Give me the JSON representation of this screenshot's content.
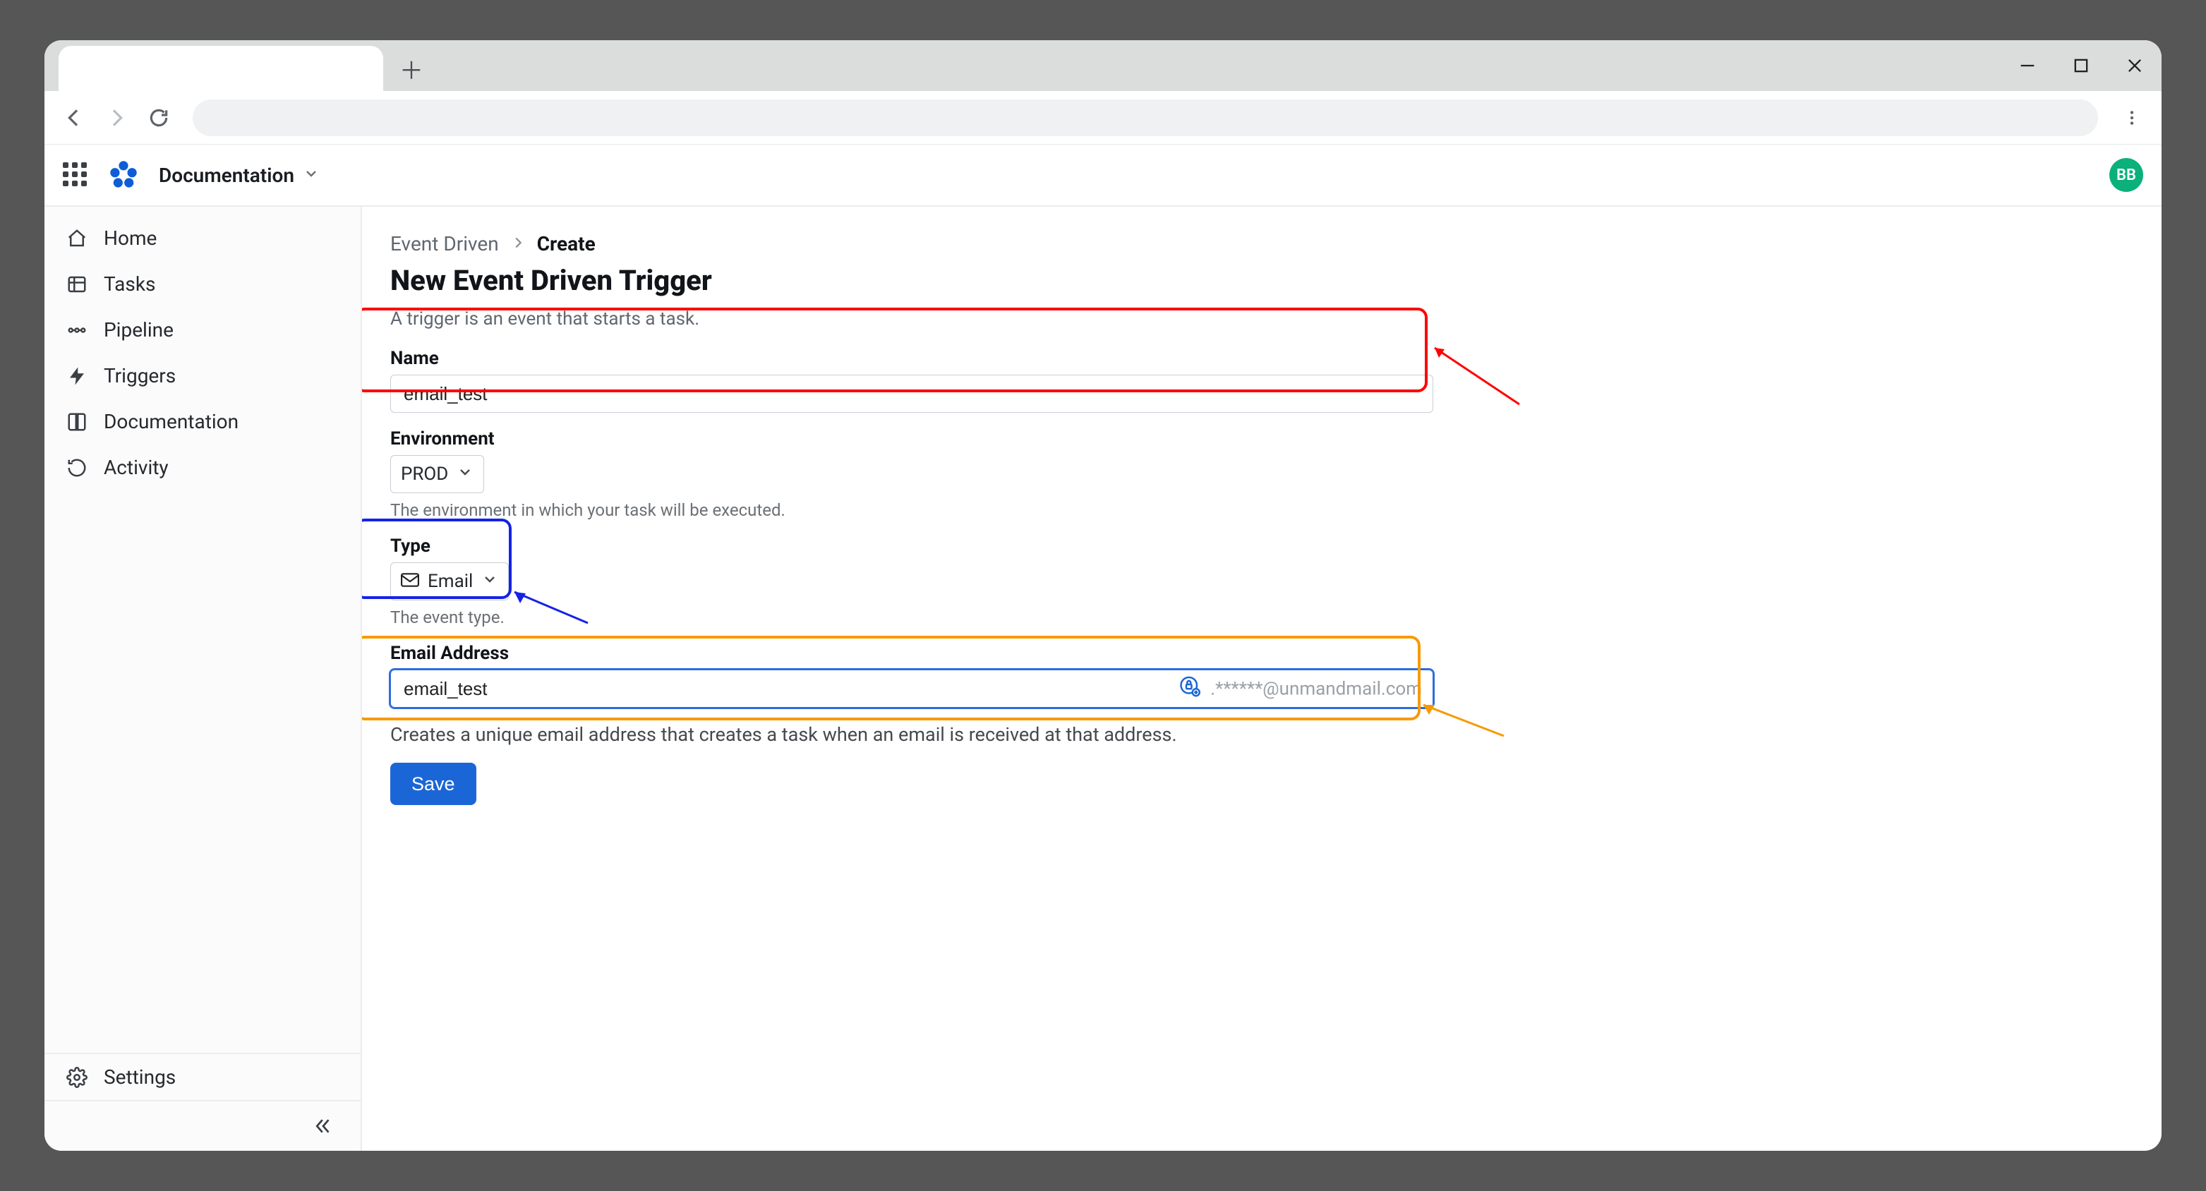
{
  "browser": {
    "tab_label": "",
    "window_controls": {
      "min": "minimize",
      "max": "maximize",
      "close": "close"
    }
  },
  "app_header": {
    "project_name": "Documentation",
    "avatar_initials": "BB"
  },
  "sidebar": {
    "items": [
      {
        "label": "Home"
      },
      {
        "label": "Tasks"
      },
      {
        "label": "Pipeline"
      },
      {
        "label": "Triggers"
      },
      {
        "label": "Documentation"
      },
      {
        "label": "Activity"
      }
    ],
    "settings_label": "Settings"
  },
  "breadcrumb": {
    "parent": "Event Driven",
    "current": "Create"
  },
  "page": {
    "title": "New Event Driven Trigger",
    "subtitle": "A trigger is an event that starts a task."
  },
  "form": {
    "name": {
      "label": "Name",
      "value": "email_test"
    },
    "environment": {
      "label": "Environment",
      "value": "PROD",
      "helper": "The environment in which your task will be executed."
    },
    "type": {
      "label": "Type",
      "value": "Email",
      "helper": "The event type."
    },
    "email": {
      "label": "Email Address",
      "value": "email_test",
      "suffix": ".******@unmandmail.com"
    },
    "description": "Creates a unique email address that creates a task when an email is received at that address.",
    "save_label": "Save"
  },
  "annotation_colors": {
    "name_box": "#ff0000",
    "type_box": "#1522e6",
    "email_box": "#f79a00"
  }
}
